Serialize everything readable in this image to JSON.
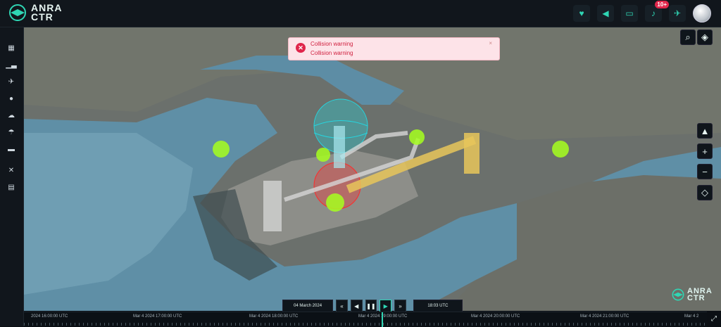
{
  "brand": {
    "line1": "ANRA",
    "line2": "CTR"
  },
  "header": {
    "icons": [
      "heart-shield-icon",
      "volume-icon",
      "chat-icon",
      "bell-icon",
      "drone-icon"
    ],
    "notification_count": "10+"
  },
  "sidebar": {
    "items": [
      "grid-icon",
      "chart-icon",
      "plane-icon",
      "circle-icon",
      "cloud-icon",
      "weather-icon",
      "folder-icon",
      "tools-icon",
      "report-icon"
    ]
  },
  "toast": {
    "title": "Collision warning",
    "message": "Collision warning",
    "type": "error"
  },
  "map_controls": {
    "search": "search-icon",
    "layers": "layers-icon",
    "mode": "terrain-icon",
    "zoom_in": "+",
    "zoom_out": "−",
    "locate": "locate-icon"
  },
  "playback": {
    "date": "04 March 2024",
    "time": "18:03 UTC",
    "controls": [
      "skip-back",
      "step-back",
      "pause",
      "play",
      "skip-forward"
    ]
  },
  "timeline": {
    "labels": [
      "2024 16:00:00 UTC",
      "Mar 4 2024 17:00:00 UTC",
      "Mar 4 2024 18:00:00 UTC",
      "Mar 4 2024 19:00:00 UTC",
      "Mar 4 2024 20:00:00 UTC",
      "Mar 4 2024 21:00:00 UTC",
      "Mar 4 2"
    ]
  },
  "colors": {
    "accent": "#2fd6b4",
    "alert": "#e0264b",
    "toast_bg": "#fde3e8",
    "drone_sphere": "#a6ff1f",
    "conflict_sphere": "#ff2a2a",
    "cyan_volume": "#25d6e0",
    "corridor": "#e8c65a"
  }
}
